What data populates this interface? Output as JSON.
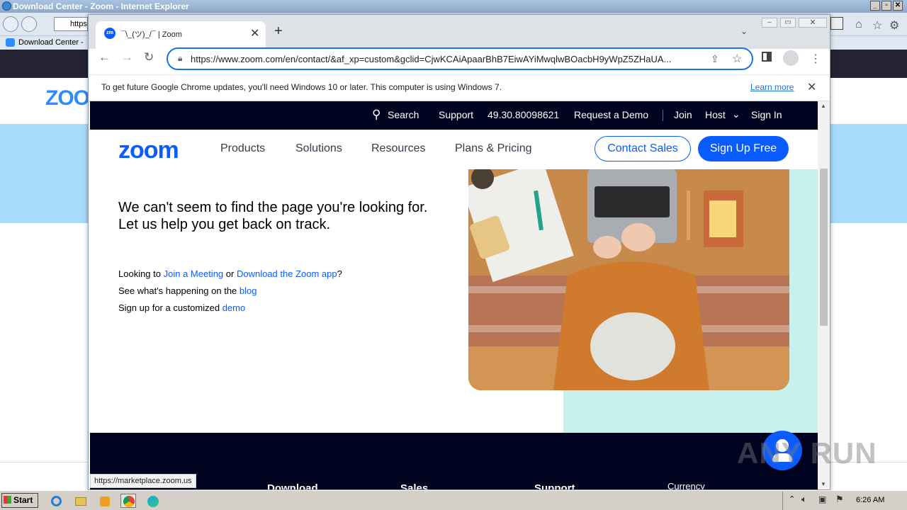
{
  "ie": {
    "title": "Download Center - Zoom - Internet Explorer",
    "address": "https",
    "tab_label": "Download Center - Z",
    "logo": "ZOO"
  },
  "chrome": {
    "tab_title": "¯\\_(ツ)_/¯ | Zoom",
    "tab_favicon": "zm",
    "url": "https://www.zoom.com/en/contact/&af_xp=custom&gclid=CjwKCAiApaarBhB7EiwAYiMwqlwBOacbH9yWpZ5ZHaUA...",
    "info_text": "To get future Google Chrome updates, you'll need Windows 10 or later. This computer is using Windows 7.",
    "info_link": "Learn more",
    "status_url": "https://marketplace.zoom.us"
  },
  "topnav": {
    "search": "Search",
    "support": "Support",
    "phone": "49.30.80098621",
    "request_demo": "Request a Demo",
    "join": "Join",
    "host": "Host",
    "sign_in": "Sign In"
  },
  "mainnav": {
    "logo": "zoom",
    "products": "Products",
    "solutions": "Solutions",
    "resources": "Resources",
    "plans": "Plans & Pricing",
    "contact_sales": "Contact Sales",
    "sign_up": "Sign Up Free"
  },
  "content": {
    "headline_1": "We can't seem to find the page you're looking for.",
    "headline_2": "Let us help you get back on track.",
    "line1_pre": "Looking to ",
    "line1_link1": "Join a Meeting",
    "line1_mid": " or ",
    "line1_link2": "Download the Zoom app",
    "line1_post": "?",
    "line2_pre": "See what's happening on the ",
    "line2_link": "blog",
    "line3_pre": "Sign up for a customized ",
    "line3_link": "demo"
  },
  "footer": {
    "col1": "Download",
    "col2": "Sales",
    "col3": "Support",
    "col4": "Currency"
  },
  "watermark": "ANY RUN",
  "taskbar": {
    "start": "Start",
    "clock": "6:26 AM"
  },
  "colors": {
    "zoom_blue": "#0b5cff",
    "navy": "#00031f",
    "chrome_focus": "#1a73e8"
  }
}
